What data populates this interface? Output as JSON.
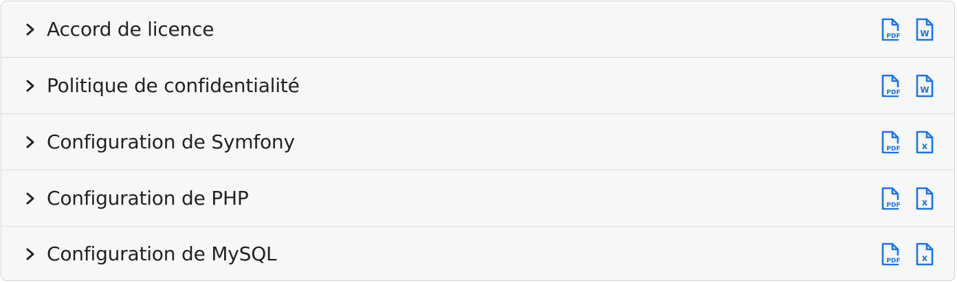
{
  "accordion": {
    "items": [
      {
        "label": "Accord de licence",
        "icons": [
          "pdf-file-icon",
          "word-file-icon"
        ],
        "badges": [
          "PDF",
          "W"
        ]
      },
      {
        "label": "Politique de confidentialité",
        "icons": [
          "pdf-file-icon",
          "word-file-icon"
        ],
        "badges": [
          "PDF",
          "W"
        ]
      },
      {
        "label": "Configuration de Symfony",
        "icons": [
          "pdf-file-icon",
          "excel-file-icon"
        ],
        "badges": [
          "PDF",
          "x"
        ]
      },
      {
        "label": "Configuration de PHP",
        "icons": [
          "pdf-file-icon",
          "excel-file-icon"
        ],
        "badges": [
          "PDF",
          "x"
        ]
      },
      {
        "label": "Configuration de MySQL",
        "icons": [
          "pdf-file-icon",
          "excel-file-icon"
        ],
        "badges": [
          "PDF",
          "x"
        ]
      }
    ]
  },
  "colors": {
    "icon": "#1a73e8",
    "text": "#222222",
    "background": "#f7f7f7",
    "border": "#d4d4d4"
  }
}
